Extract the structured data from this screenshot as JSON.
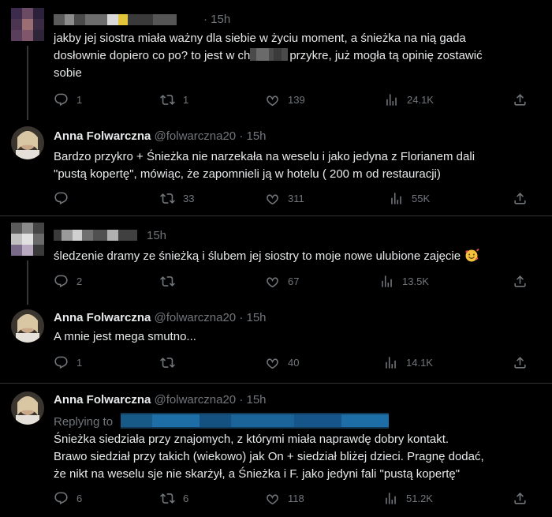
{
  "tweets": [
    {
      "time": "· 15h",
      "text_lines": [
        "jakby jej siostra miała ważny dla siebie w życiu moment, a śnieżka na nią gada",
        "dosłownie dopiero co po? to jest w ch",
        "przykre, już mogła tą opinię zostawić",
        "sobie"
      ],
      "replies": "1",
      "retweets": "1",
      "likes": "139",
      "views": "24.1K"
    },
    {
      "name": "Anna Folwarczna",
      "handle": "@folwarczna20",
      "time": "· 15h",
      "text_lines": [
        "Bardzo przykro + Śnieżka nie narzekała na weselu i jako jedyna z Florianem dali",
        "\"pustą kopertę\", mówiąc, że zapomnieli ją w hotelu ( 200 m od restauracji)"
      ],
      "replies": "",
      "retweets": "33",
      "likes": "311",
      "views": "55K"
    },
    {
      "time": "15h",
      "text_lines": [
        "śledzenie dramy ze śnieżką i ślubem jej siostry to moje nowe ulubione zajęcie"
      ],
      "replies": "2",
      "retweets": "",
      "likes": "67",
      "views": "13.5K"
    },
    {
      "name": "Anna Folwarczna",
      "handle": "@folwarczna20",
      "time": "· 15h",
      "text_lines": [
        "A mnie jest mega smutno..."
      ],
      "replies": "1",
      "retweets": "",
      "likes": "40",
      "views": "14.1K"
    },
    {
      "name": "Anna Folwarczna",
      "handle": "@folwarczna20",
      "time": "· 15h",
      "replying_to": "Replying to",
      "text_lines": [
        "Śnieżka siedziała przy znajomych, z którymi miała naprawdę dobry kontakt.",
        "Brawo siedział przy takich (wiekowo) jak On + siedział bliżej dzieci. Pragnę dodać,",
        "że nikt na weselu sje nie skarżył, a Śnieżka i F. jako jedyni fali \"pustą kopertę\""
      ],
      "replies": "6",
      "retweets": "6",
      "likes": "118",
      "views": "51.2K"
    }
  ],
  "colors": {
    "text": "#e7e9ea",
    "muted": "#71767b",
    "divider": "#2f3336",
    "link": "#1d9bf0"
  },
  "icons": [
    "reply-icon",
    "retweet-icon",
    "like-icon",
    "views-icon",
    "share-icon"
  ]
}
